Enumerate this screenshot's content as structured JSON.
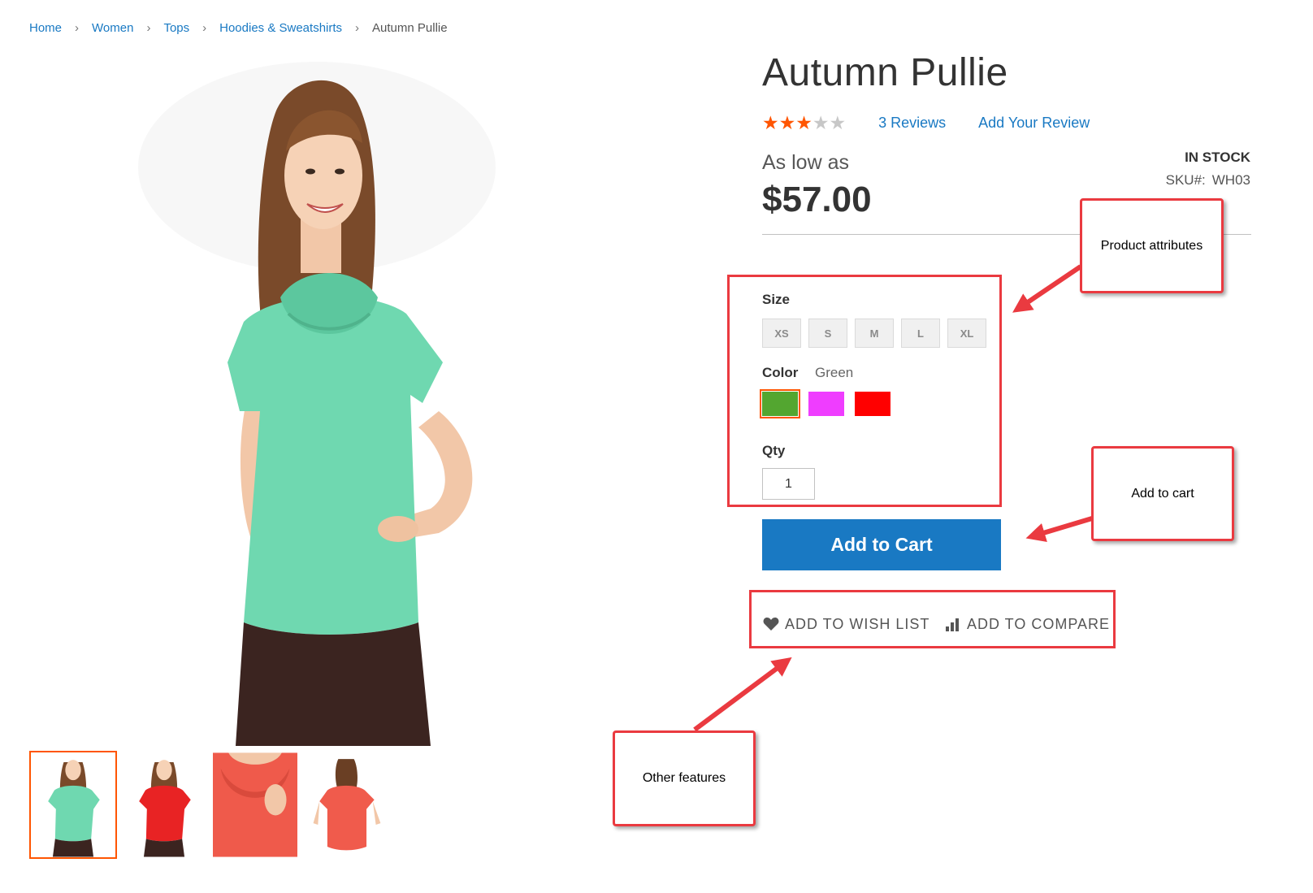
{
  "breadcrumb": {
    "items": [
      "Home",
      "Women",
      "Tops",
      "Hoodies & Sweatshirts"
    ],
    "current": "Autumn Pullie",
    "separator": "›"
  },
  "product": {
    "name": "Autumn Pullie",
    "rating": {
      "stars_filled": 3,
      "stars_total": 5
    },
    "reviews_link": "3  Reviews",
    "add_review_link": "Add Your Review",
    "price_label": "As low as",
    "price": "$57.00",
    "stock_status": "In stock",
    "sku_label": "SKU#:",
    "sku_value": "WH03"
  },
  "options": {
    "size_label": "Size",
    "sizes": [
      "XS",
      "S",
      "M",
      "L",
      "XL"
    ],
    "color_label": "Color",
    "color_selected": "Green",
    "colors": [
      {
        "name": "Green",
        "hex": "#53a630",
        "selected": true
      },
      {
        "name": "Purple",
        "hex": "#ef3dff",
        "selected": false
      },
      {
        "name": "Red",
        "hex": "#ff0000",
        "selected": false
      }
    ],
    "qty_label": "Qty",
    "qty_value": "1"
  },
  "actions": {
    "add_to_cart": "Add to Cart",
    "wish_list": "Add to Wish List",
    "compare": "Add to Compare",
    "wish_icon": "heart-icon",
    "compare_icon": "bar-chart-icon"
  },
  "gallery": {
    "thumbnails": [
      {
        "icon": "model-mint-top-front",
        "color": "#6fd8b0",
        "active": true
      },
      {
        "icon": "model-red-top-front",
        "color": "#e82324",
        "active": false
      },
      {
        "icon": "model-coral-top-closeup",
        "color": "#ef5a4b",
        "active": false
      },
      {
        "icon": "model-coral-top-back",
        "color": "#f05b4c",
        "active": false
      }
    ]
  },
  "annotations": {
    "product_attributes": "Product attributes",
    "add_to_cart": "Add to cart",
    "other_features": "Other features"
  },
  "colors": {
    "link": "#1979c3",
    "accent": "#ff5501",
    "button": "#1979c3",
    "annotation": "#ea3a40"
  }
}
